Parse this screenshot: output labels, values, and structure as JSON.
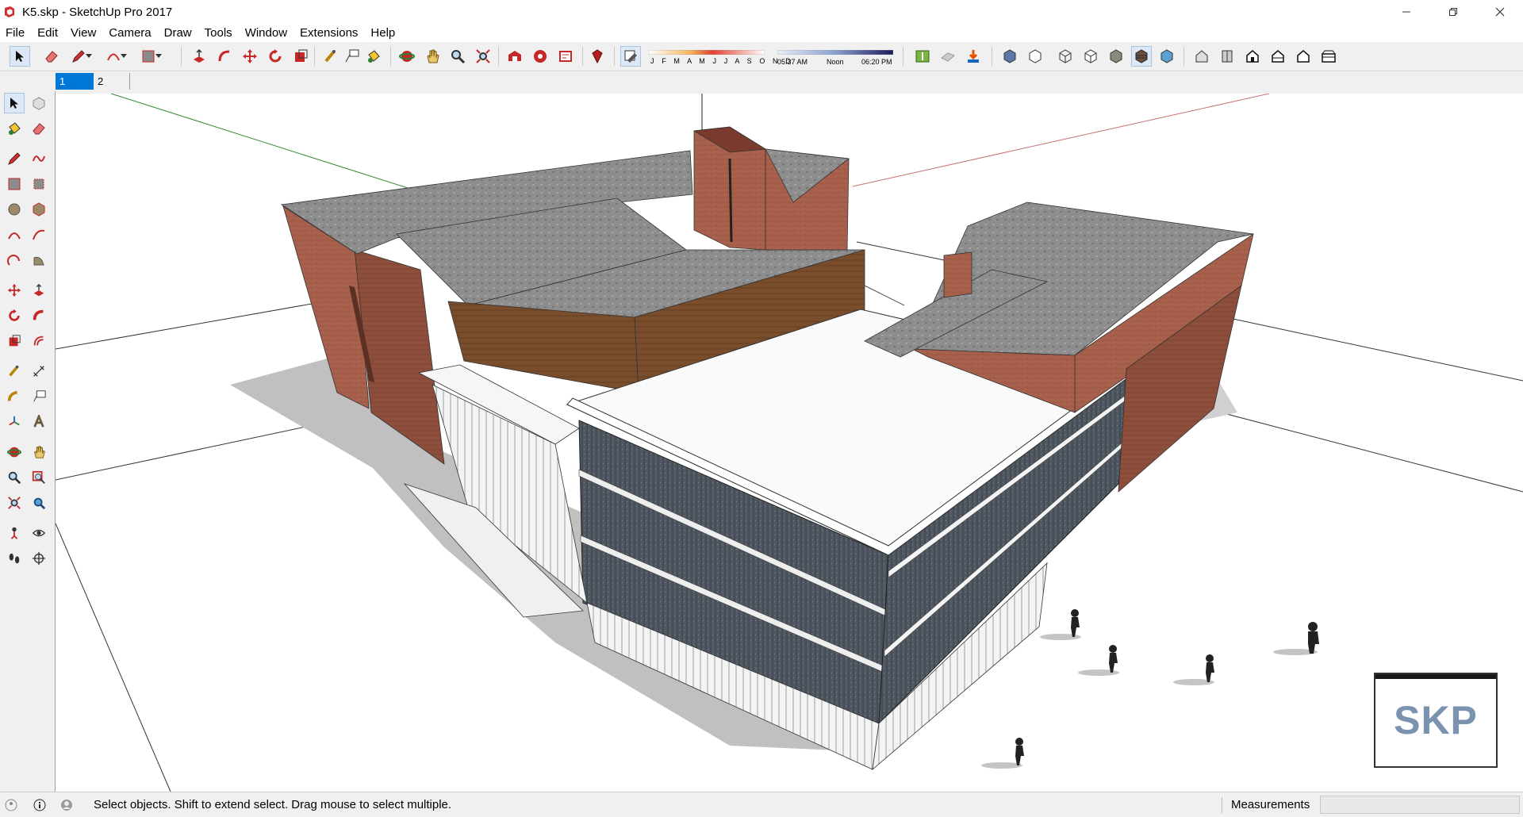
{
  "window": {
    "title": "K5.skp - SketchUp Pro 2017",
    "controls": [
      "minimize",
      "restore",
      "close"
    ]
  },
  "menu": [
    "File",
    "Edit",
    "View",
    "Camera",
    "Draw",
    "Tools",
    "Window",
    "Extensions",
    "Help"
  ],
  "shadows": {
    "months": "J F M A M J J A S O N D",
    "time_start": "05:37 AM",
    "time_mid": "Noon",
    "time_end": "06:20 PM"
  },
  "scenes": {
    "tabs": [
      "1",
      "2"
    ],
    "active": "1"
  },
  "status": {
    "hint": "Select objects. Shift to extend select. Drag mouse to select multiple.",
    "measurements_label": "Measurements",
    "measurements_value": ""
  },
  "watermark": "SKP",
  "colors": {
    "brick": "#a8614c",
    "roof": "#8a8a8a",
    "wood": "#7a4e2c",
    "glass": "#4a525c",
    "red_axis": "#c87070",
    "green_axis": "#2e8b2e",
    "selection_blue": "#0078d7"
  }
}
